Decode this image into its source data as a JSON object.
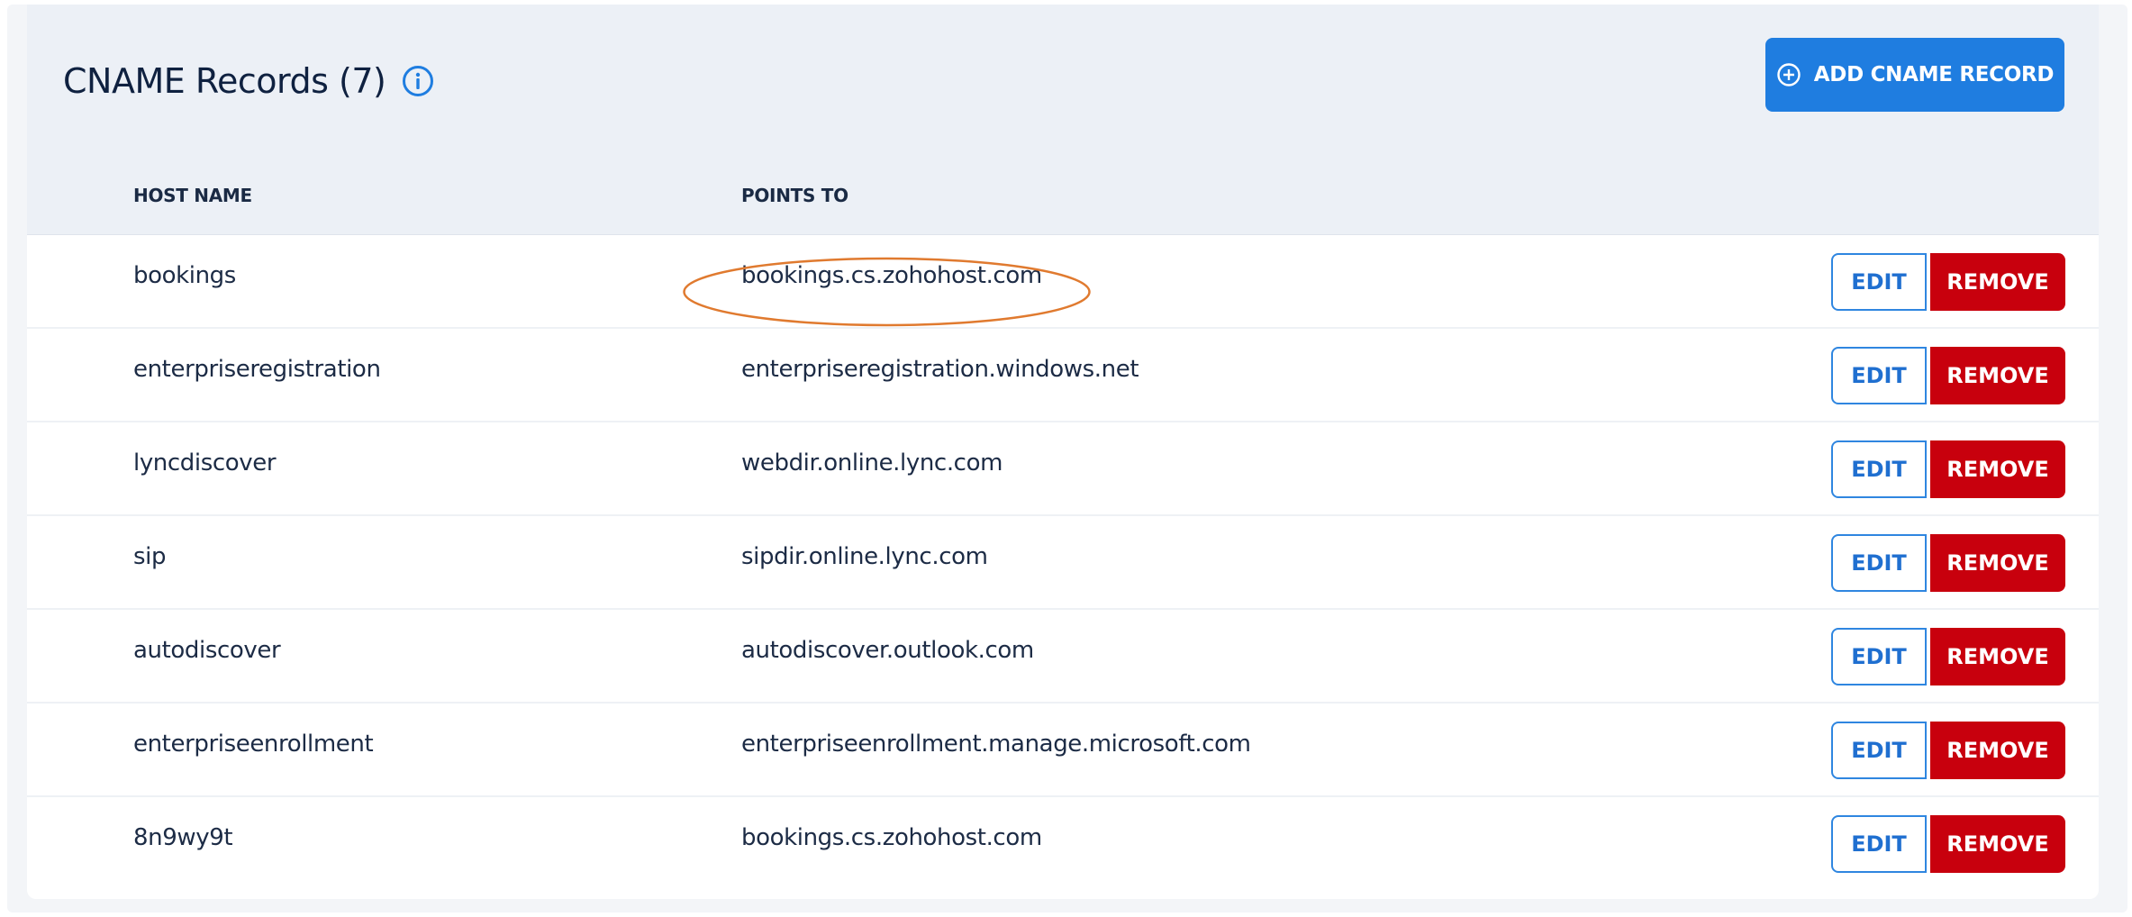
{
  "header": {
    "title": "CNAME Records (7)",
    "add_button_label": "ADD CNAME RECORD"
  },
  "columns": {
    "host_name": "HOST NAME",
    "points_to": "POINTS TO"
  },
  "actions": {
    "edit_label": "EDIT",
    "remove_label": "REMOVE"
  },
  "records": [
    {
      "host": "bookings",
      "points_to": "bookings.cs.zohohost.com",
      "highlighted": true
    },
    {
      "host": "enterpriseregistration",
      "points_to": "enterpriseregistration.windows.net"
    },
    {
      "host": "lyncdiscover",
      "points_to": "webdir.online.lync.com"
    },
    {
      "host": "sip",
      "points_to": "sipdir.online.lync.com"
    },
    {
      "host": "autodiscover",
      "points_to": "autodiscover.outlook.com"
    },
    {
      "host": "enterpriseenrollment",
      "points_to": "enterpriseenrollment.manage.microsoft.com"
    },
    {
      "host": "8n9wy9t",
      "points_to": "bookings.cs.zohohost.com"
    }
  ],
  "icons": {
    "info": "info-icon",
    "add": "plus-circle-icon"
  },
  "colors": {
    "accent": "#1f7de0",
    "danger": "#c8000d",
    "header_bg": "#ecf0f6",
    "highlight_annotation": "#e07a2f"
  }
}
